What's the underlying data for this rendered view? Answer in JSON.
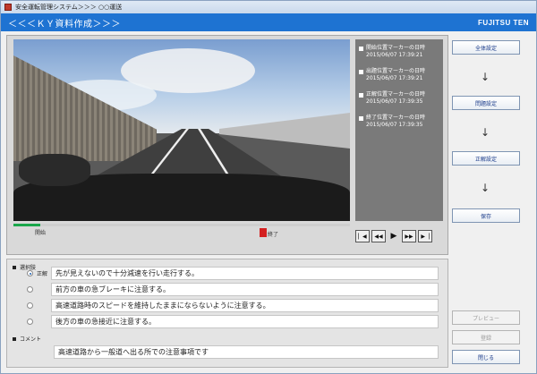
{
  "window": {
    "title": "安全運転管理システム＞＞＞ ○○運送"
  },
  "header": {
    "screen_title": "＜＜＜ＫＹ資料作成＞＞＞",
    "logo_text": "FUJITSU TEN"
  },
  "video": {
    "progress_fraction": 0.08,
    "start_marker_label": "開始",
    "end_marker_label": "終了"
  },
  "markers": [
    {
      "label": "開始位置マーカーの日時",
      "datetime": "2015/06/07 17:39:21"
    },
    {
      "label": "出題位置マーカーの日時",
      "datetime": "2015/06/07 17:39:21"
    },
    {
      "label": "正解位置マーカーの日時",
      "datetime": "2015/06/07 17:39:35"
    },
    {
      "label": "終了位置マーカーの日時",
      "datetime": "2015/06/07 17:39:35"
    }
  ],
  "player": {
    "buttons": [
      "prev-frame-icon",
      "rewind-icon",
      "play-icon",
      "fast-forward-icon",
      "next-frame-icon"
    ]
  },
  "steps": {
    "overall_settings": "全体設定",
    "question_settings": "問題設定",
    "answer_settings": "正解設定",
    "save": "保存",
    "arrow": "↓"
  },
  "choices_section": {
    "label": "選択肢",
    "correct_tag": "正解",
    "items": [
      {
        "text": "先が見えないので十分減速を行い走行する。",
        "checked": true
      },
      {
        "text": "前方の車の急ブレーキに注意する。",
        "checked": false
      },
      {
        "text": "高速道路時のスピードを維持したままにならないように注意する。",
        "checked": false
      },
      {
        "text": "後方の車の急接近に注意する。",
        "checked": false
      }
    ]
  },
  "comment_section": {
    "label": "コメント",
    "value": "高速道路から一般道へ出る所での注意事項です"
  },
  "footer_buttons": {
    "preview": "プレビュー",
    "register": "登録",
    "close": "閉じる"
  },
  "colors": {
    "header_blue": "#1e73d2",
    "progress_green": "#1aa64a",
    "end_marker_red": "#d42020"
  }
}
